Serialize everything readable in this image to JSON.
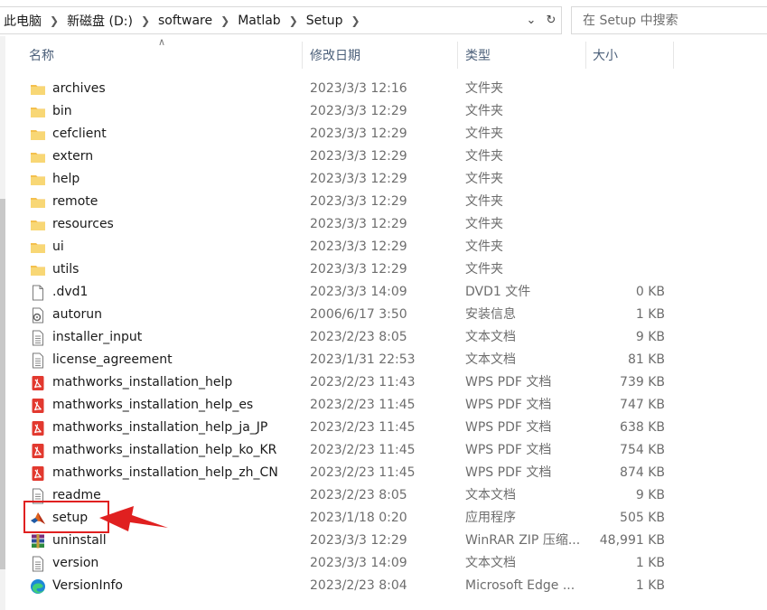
{
  "address": {
    "crumbs": [
      "此电脑",
      "新磁盘 (D:)",
      "software",
      "Matlab",
      "Setup"
    ],
    "dropdown_icon": "chevron-down-icon",
    "refresh_icon": "refresh-icon"
  },
  "search": {
    "placeholder": "在 Setup 中搜索"
  },
  "columns": {
    "name": "名称",
    "date": "修改日期",
    "type": "类型",
    "size": "大小"
  },
  "files": [
    {
      "name": "archives",
      "date": "2023/3/3 12:16",
      "type": "文件夹",
      "size": "",
      "icon": "folder-icon"
    },
    {
      "name": "bin",
      "date": "2023/3/3 12:29",
      "type": "文件夹",
      "size": "",
      "icon": "folder-icon"
    },
    {
      "name": "cefclient",
      "date": "2023/3/3 12:29",
      "type": "文件夹",
      "size": "",
      "icon": "folder-icon"
    },
    {
      "name": "extern",
      "date": "2023/3/3 12:29",
      "type": "文件夹",
      "size": "",
      "icon": "folder-icon"
    },
    {
      "name": "help",
      "date": "2023/3/3 12:29",
      "type": "文件夹",
      "size": "",
      "icon": "folder-icon"
    },
    {
      "name": "remote",
      "date": "2023/3/3 12:29",
      "type": "文件夹",
      "size": "",
      "icon": "folder-icon"
    },
    {
      "name": "resources",
      "date": "2023/3/3 12:29",
      "type": "文件夹",
      "size": "",
      "icon": "folder-icon"
    },
    {
      "name": "ui",
      "date": "2023/3/3 12:29",
      "type": "文件夹",
      "size": "",
      "icon": "folder-icon"
    },
    {
      "name": "utils",
      "date": "2023/3/3 12:29",
      "type": "文件夹",
      "size": "",
      "icon": "folder-icon"
    },
    {
      "name": ".dvd1",
      "date": "2023/3/3 14:09",
      "type": "DVD1 文件",
      "size": "0 KB",
      "icon": "blank-file-icon"
    },
    {
      "name": "autorun",
      "date": "2006/6/17 3:50",
      "type": "安装信息",
      "size": "1 KB",
      "icon": "setup-info-icon"
    },
    {
      "name": "installer_input",
      "date": "2023/2/23 8:05",
      "type": "文本文档",
      "size": "9 KB",
      "icon": "text-file-icon"
    },
    {
      "name": "license_agreement",
      "date": "2023/1/31 22:53",
      "type": "文本文档",
      "size": "81 KB",
      "icon": "text-file-icon"
    },
    {
      "name": "mathworks_installation_help",
      "date": "2023/2/23 11:43",
      "type": "WPS PDF 文档",
      "size": "739 KB",
      "icon": "pdf-icon"
    },
    {
      "name": "mathworks_installation_help_es",
      "date": "2023/2/23 11:45",
      "type": "WPS PDF 文档",
      "size": "747 KB",
      "icon": "pdf-icon"
    },
    {
      "name": "mathworks_installation_help_ja_JP",
      "date": "2023/2/23 11:45",
      "type": "WPS PDF 文档",
      "size": "638 KB",
      "icon": "pdf-icon"
    },
    {
      "name": "mathworks_installation_help_ko_KR",
      "date": "2023/2/23 11:45",
      "type": "WPS PDF 文档",
      "size": "754 KB",
      "icon": "pdf-icon"
    },
    {
      "name": "mathworks_installation_help_zh_CN",
      "date": "2023/2/23 11:45",
      "type": "WPS PDF 文档",
      "size": "874 KB",
      "icon": "pdf-icon"
    },
    {
      "name": "readme",
      "date": "2023/2/23 8:05",
      "type": "文本文档",
      "size": "9 KB",
      "icon": "text-file-icon"
    },
    {
      "name": "setup",
      "date": "2023/1/18 0:20",
      "type": "应用程序",
      "size": "505 KB",
      "icon": "matlab-icon"
    },
    {
      "name": "uninstall",
      "date": "2023/3/3 12:29",
      "type": "WinRAR ZIP 压缩...",
      "size": "48,991 KB",
      "icon": "winrar-icon"
    },
    {
      "name": "version",
      "date": "2023/3/3 14:09",
      "type": "文本文档",
      "size": "1 KB",
      "icon": "text-file-icon"
    },
    {
      "name": "VersionInfo",
      "date": "2023/2/23 8:04",
      "type": "Microsoft Edge ...",
      "size": "1 KB",
      "icon": "edge-icon"
    }
  ],
  "colors": {
    "highlight": "#e02020",
    "folder": "#f4c04e",
    "header_text": "#4c607a"
  }
}
